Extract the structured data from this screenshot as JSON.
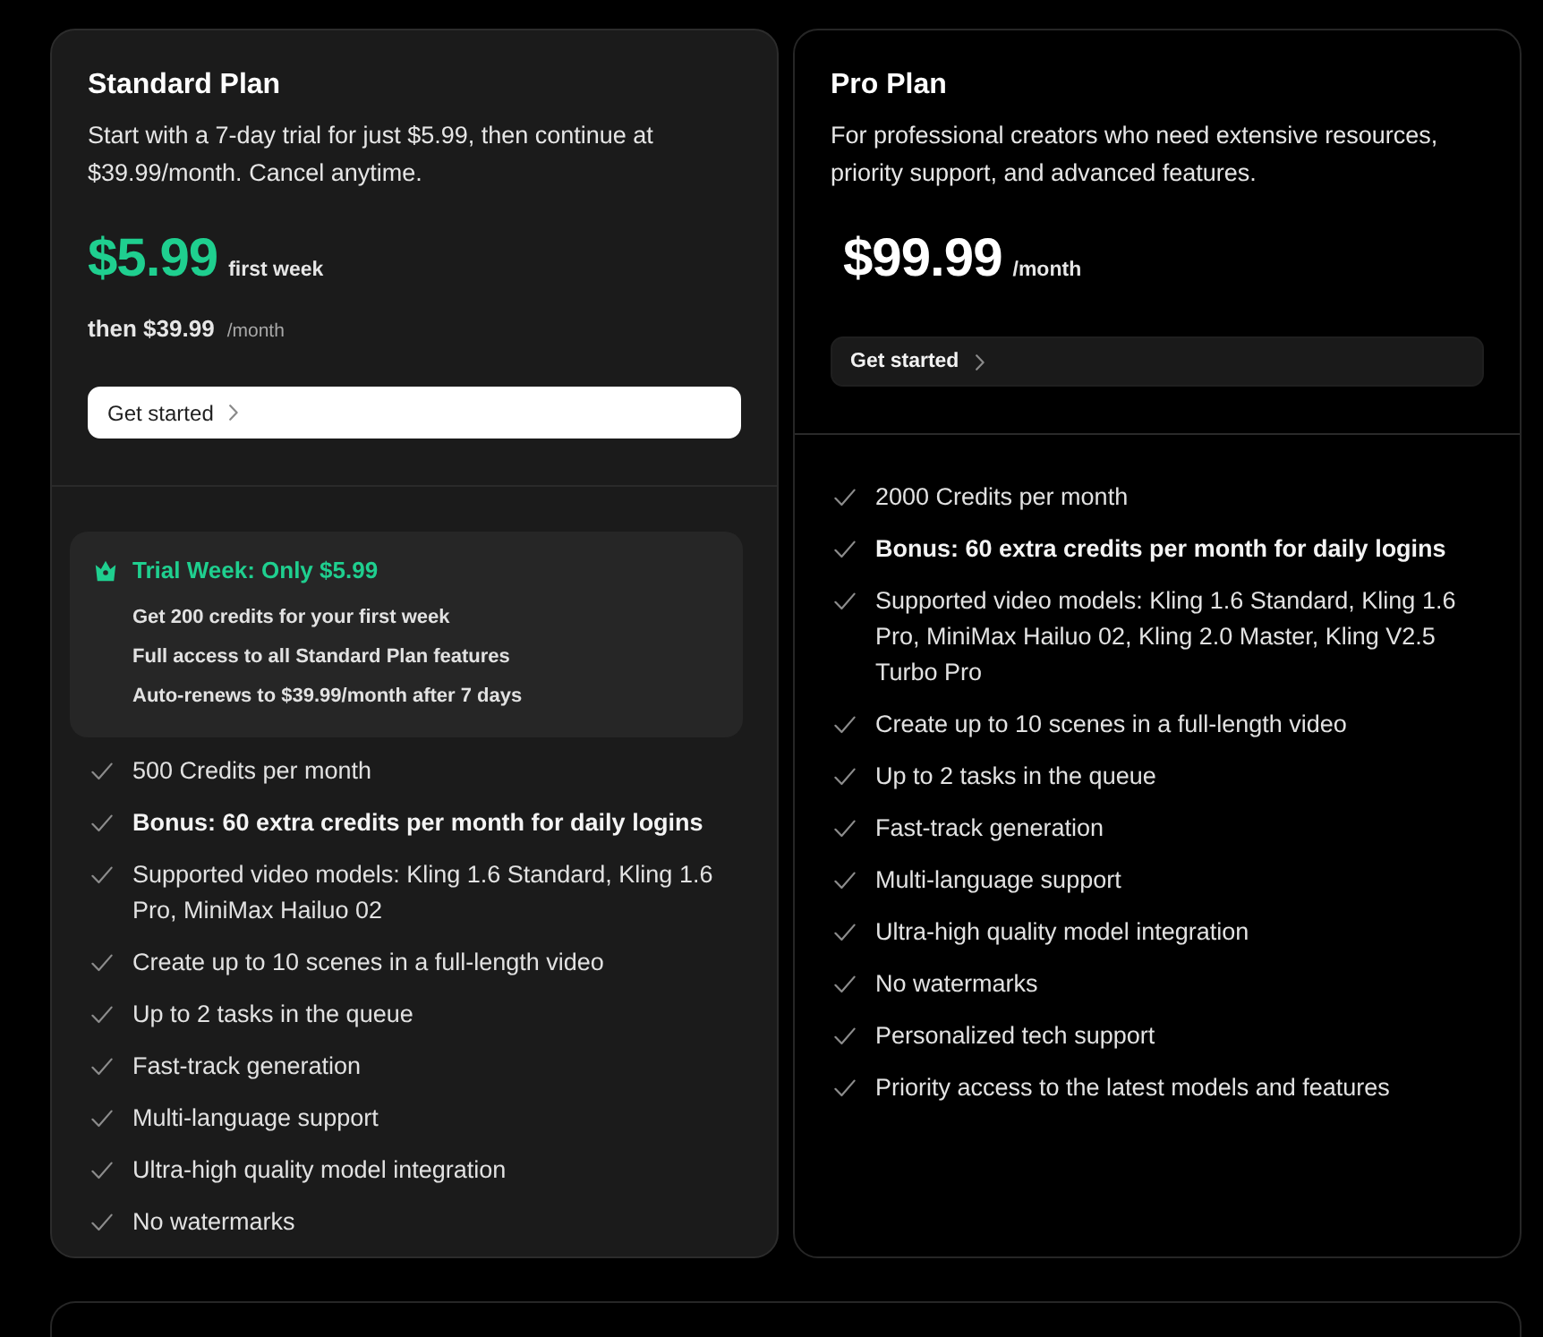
{
  "plans": [
    {
      "kind": "trial",
      "title": "Standard Plan",
      "description": "Start with a 7-day trial for just $5.99, then continue at $39.99/month. Cancel anytime.",
      "price": {
        "amount": "$5.99",
        "period": "first week"
      },
      "renewal": {
        "amount": "then $39.99",
        "period": "/month"
      },
      "button": {
        "label": "Get started"
      },
      "trial_offer": {
        "title": "Trial Week: Only $5.99",
        "items": [
          "Get 200 credits for your first week",
          "Full access to all Standard Plan features",
          "Auto-renews to $39.99/month after 7 days"
        ]
      },
      "features": [
        {
          "text": "500 Credits per month",
          "bold": false
        },
        {
          "text": "Bonus: 60 extra credits per month for daily logins",
          "bold": true
        },
        {
          "text": "Supported video models: Kling 1.6 Standard, Kling 1.6 Pro, MiniMax Hailuo 02",
          "bold": false
        },
        {
          "text": "Create up to 10 scenes in a full-length video",
          "bold": false
        },
        {
          "text": "Up to 2 tasks in the queue",
          "bold": false
        },
        {
          "text": "Fast-track generation",
          "bold": false
        },
        {
          "text": "Multi-language support",
          "bold": false
        },
        {
          "text": "Ultra-high quality model integration",
          "bold": false
        },
        {
          "text": "No watermarks",
          "bold": false
        }
      ]
    },
    {
      "kind": "regular",
      "title": "Pro Plan",
      "description": "For professional creators who need extensive resources, priority support, and advanced features.",
      "price": {
        "amount": "$99.99",
        "period": "/month"
      },
      "button": {
        "label": "Get started"
      },
      "features": [
        {
          "text": "2000 Credits per month",
          "bold": false
        },
        {
          "text": "Bonus: 60 extra credits per month for daily logins",
          "bold": true
        },
        {
          "text": "Supported video models: Kling 1.6 Standard, Kling 1.6 Pro, MiniMax Hailuo 02, Kling 2.0 Master, Kling V2.5 Turbo Pro",
          "bold": false
        },
        {
          "text": "Create up to 10 scenes in a full-length video",
          "bold": false
        },
        {
          "text": "Up to 2 tasks in the queue",
          "bold": false
        },
        {
          "text": "Fast-track generation",
          "bold": false
        },
        {
          "text": "Multi-language support",
          "bold": false
        },
        {
          "text": "Ultra-high quality model integration",
          "bold": false
        },
        {
          "text": "No watermarks",
          "bold": false
        },
        {
          "text": "Personalized tech support",
          "bold": false
        },
        {
          "text": "Priority access to the latest models and features",
          "bold": false
        }
      ]
    }
  ]
}
